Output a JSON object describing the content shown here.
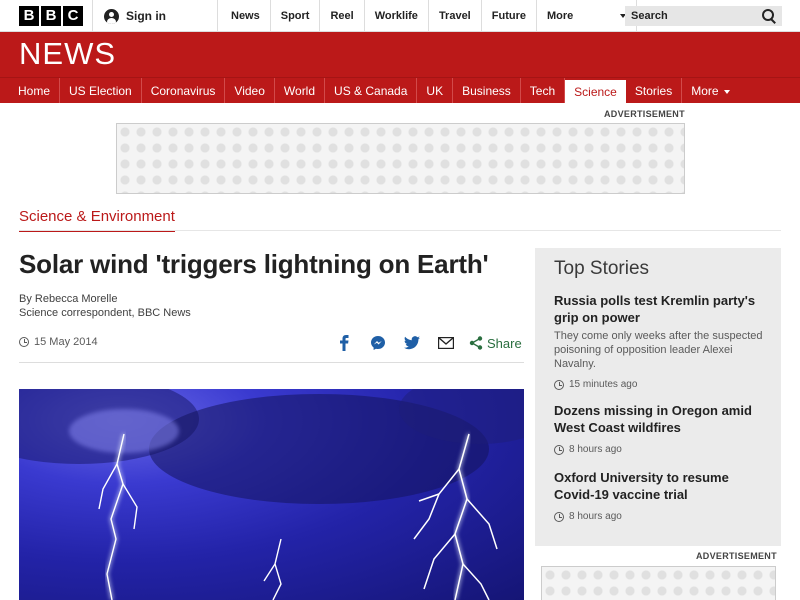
{
  "topbar": {
    "logo_letters": [
      "B",
      "B",
      "C"
    ],
    "signin_label": "Sign in",
    "nav": [
      "News",
      "Sport",
      "Reel",
      "Worklife",
      "Travel",
      "Future"
    ],
    "more_label": "More",
    "search_placeholder": "Search"
  },
  "brand": {
    "news_word": "NEWS",
    "color": "#bb1919"
  },
  "navbar": {
    "items": [
      "Home",
      "US Election",
      "Coronavirus",
      "Video",
      "World",
      "US & Canada",
      "UK",
      "Business",
      "Tech",
      "Science",
      "Stories",
      "More"
    ],
    "active": "Science"
  },
  "ads": {
    "label": "ADVERTISEMENT"
  },
  "section": {
    "label": "Science & Environment"
  },
  "article": {
    "headline": "Solar wind 'triggers lightning on Earth'",
    "author": "By Rebecca Morelle",
    "role": "Science correspondent, BBC News",
    "date": "15 May 2014",
    "share_label": "Share",
    "share_icons": [
      "facebook-icon",
      "messenger-icon",
      "twitter-icon",
      "email-icon",
      "share-icon"
    ]
  },
  "top_stories": {
    "title": "Top Stories",
    "stories": [
      {
        "title": "Russia polls test Kremlin party's grip on power",
        "summary": "They come only weeks after the suspected poisoning of opposition leader Alexei Navalny.",
        "time": "15 minutes ago"
      },
      {
        "title": "Dozens missing in Oregon amid West Coast wildfires",
        "summary": "",
        "time": "8 hours ago"
      },
      {
        "title": "Oxford University to resume Covid-19 vaccine trial",
        "summary": "",
        "time": "8 hours ago"
      }
    ]
  }
}
